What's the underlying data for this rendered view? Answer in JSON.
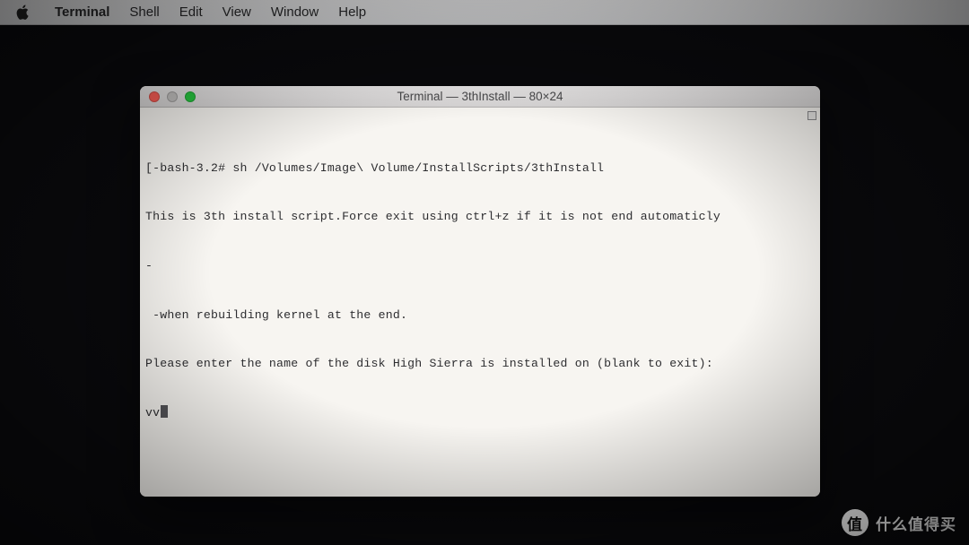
{
  "menubar": {
    "app_name": "Terminal",
    "items": [
      "Shell",
      "Edit",
      "View",
      "Window",
      "Help"
    ]
  },
  "window": {
    "title": "Terminal — 3thInstall — 80×24"
  },
  "terminal": {
    "lines": [
      "[-bash-3.2# sh /Volumes/Image\\ Volume/InstallScripts/3thInstall",
      "This is 3th install script.Force exit using ctrl+z if it is not end automaticly",
      "-",
      " -when rebuilding kernel at the end.",
      "Please enter the name of the disk High Sierra is installed on (blank to exit):"
    ],
    "input": "vv"
  },
  "brand": {
    "badge": "值",
    "text": "什么值得买"
  }
}
